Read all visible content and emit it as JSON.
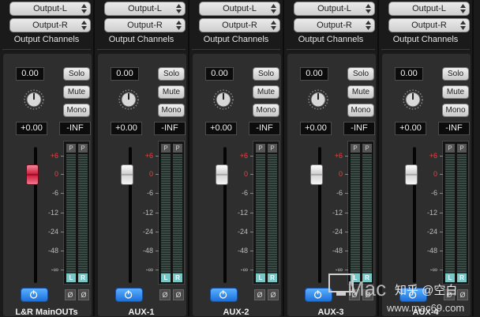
{
  "strips": [
    {
      "out_l": "Output-L",
      "out_r": "Output-R",
      "channels_label": "Output Channels",
      "pan": "0.00",
      "solo": "Solo",
      "mute": "Mute",
      "mono": "Mono",
      "gain": "+0.00",
      "peak": "-INF",
      "p1": "P",
      "p2": "P",
      "l": "L",
      "r": "R",
      "phase1": "Ø",
      "phase2": "Ø",
      "name": "L&R MainOUTs",
      "fader_color": "red",
      "fader_level": "0 dB"
    },
    {
      "out_l": "Output-L",
      "out_r": "Output-R",
      "channels_label": "Output Channels",
      "pan": "0.00",
      "solo": "Solo",
      "mute": "Mute",
      "mono": "Mono",
      "gain": "+0.00",
      "peak": "-INF",
      "p1": "P",
      "p2": "P",
      "l": "L",
      "r": "R",
      "phase1": "Ø",
      "phase2": "Ø",
      "name": "AUX-1",
      "fader_color": "silver",
      "fader_level": "0 dB"
    },
    {
      "out_l": "Output-L",
      "out_r": "Output-R",
      "channels_label": "Output Channels",
      "pan": "0.00",
      "solo": "Solo",
      "mute": "Mute",
      "mono": "Mono",
      "gain": "+0.00",
      "peak": "-INF",
      "p1": "P",
      "p2": "P",
      "l": "L",
      "r": "R",
      "phase1": "Ø",
      "phase2": "Ø",
      "name": "AUX-2",
      "fader_color": "silver",
      "fader_level": "0 dB"
    },
    {
      "out_l": "Output-L",
      "out_r": "Output-R",
      "channels_label": "Output Channels",
      "pan": "0.00",
      "solo": "Solo",
      "mute": "Mute",
      "mono": "Mono",
      "gain": "+0.00",
      "peak": "-INF",
      "p1": "P",
      "p2": "P",
      "l": "L",
      "r": "R",
      "phase1": "Ø",
      "phase2": "Ø",
      "name": "AUX-3",
      "fader_color": "silver",
      "fader_level": "0 dB"
    },
    {
      "out_l": "Output-L",
      "out_r": "Output-R",
      "channels_label": "Output Channels",
      "pan": "0.00",
      "solo": "Solo",
      "mute": "Mute",
      "mono": "Mono",
      "gain": "+0.00",
      "peak": "-INF",
      "p1": "P",
      "p2": "P",
      "l": "L",
      "r": "R",
      "phase1": "Ø",
      "phase2": "Ø",
      "name": "AUX-4",
      "fader_color": "silver",
      "fader_level": "0 dB"
    }
  ],
  "scale_labels": [
    "+6",
    "0",
    "-6",
    "-12",
    "-24",
    "-48",
    "-∞"
  ],
  "scale_red": [
    "+6",
    "0"
  ],
  "colors": {
    "power_button": "#1d70d8",
    "meter_lr": "#78c8c8",
    "fader_red": "#d22040",
    "scale_red": "#e04848"
  },
  "icons": {
    "power": "power-icon",
    "knob": "pan-knob-icon",
    "selector": "updown-arrows-icon"
  },
  "watermark": {
    "logo": "Mac",
    "brand": "知乎 @空白",
    "url": "www.mac69.com"
  }
}
